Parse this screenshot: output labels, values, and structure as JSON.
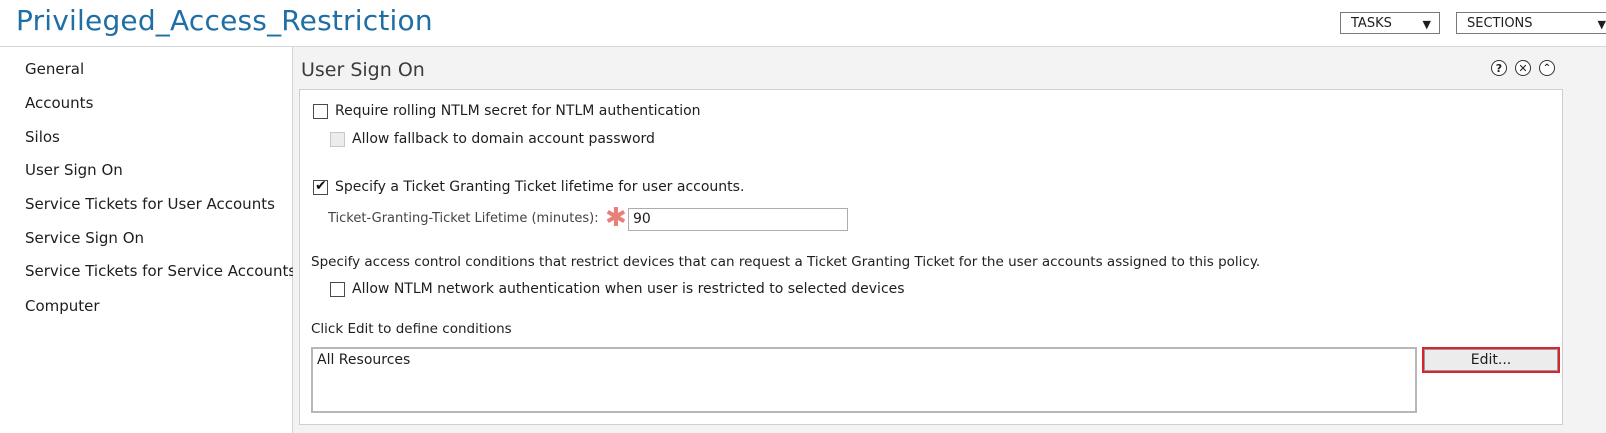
{
  "header": {
    "title": "Privileged_Access_Restriction",
    "tasks_label": "TASKS",
    "sections_label": "SECTIONS"
  },
  "sidebar": {
    "items": [
      {
        "label": "General"
      },
      {
        "label": "Accounts"
      },
      {
        "label": "Silos"
      },
      {
        "label": "User Sign On"
      },
      {
        "label": "Service Tickets for User Accounts"
      },
      {
        "label": "Service Sign On"
      },
      {
        "label": "Service Tickets for Service Accounts"
      },
      {
        "label": "Computer"
      }
    ]
  },
  "section": {
    "title": "User Sign On",
    "help_glyph": "?",
    "close_glyph": "✕",
    "collapse_glyph": "⌃"
  },
  "form": {
    "ntlm_rolling": {
      "label": "Require rolling NTLM secret for NTLM authentication",
      "checked": false
    },
    "fallback": {
      "label": "Allow fallback to domain account password",
      "checked": false,
      "disabled": true
    },
    "tgt_lifetime": {
      "label": "Specify a Ticket Granting Ticket lifetime for user accounts.",
      "checked": true,
      "check_glyph": "✔"
    },
    "tgt_field": {
      "label": "Ticket-Granting-Ticket Lifetime (minutes):",
      "required_glyph": "✱",
      "value": "90"
    },
    "access_desc": "Specify access control conditions that restrict devices that can request a Ticket Granting Ticket for the user accounts assigned to this policy.",
    "ntlm_restricted": {
      "label": "Allow NTLM network authentication when user is restricted to selected devices",
      "checked": false
    },
    "conditions_label": "Click Edit to define conditions",
    "conditions_value": "All Resources",
    "edit_label": "Edit..."
  }
}
